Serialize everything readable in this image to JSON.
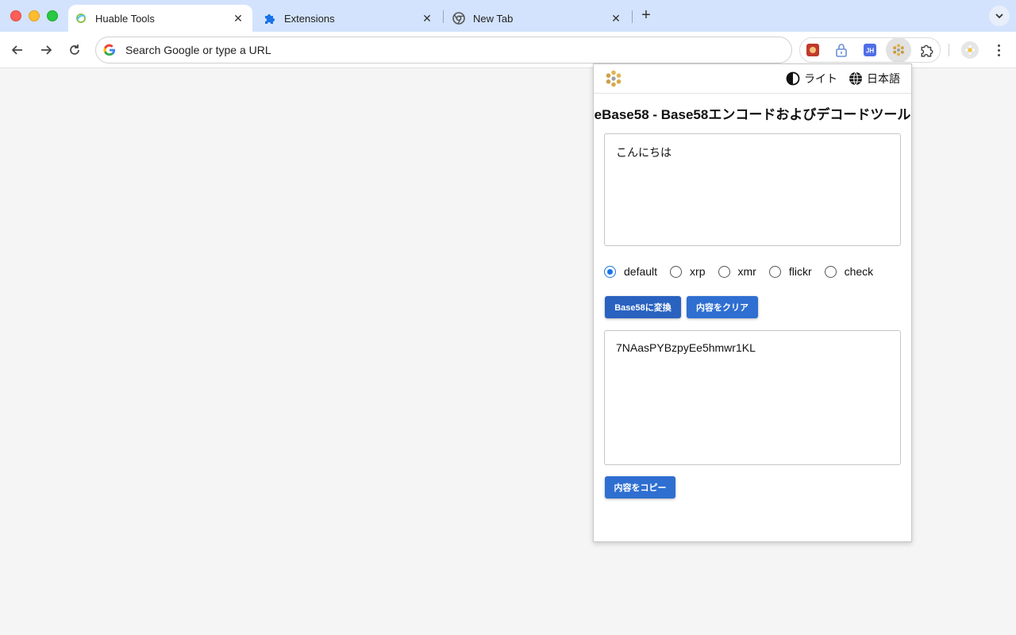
{
  "browser": {
    "tabs": [
      {
        "title": "Huable Tools",
        "active": true,
        "icon": "huable-icon"
      },
      {
        "title": "Extensions",
        "active": false,
        "icon": "puzzle-icon"
      },
      {
        "title": "New Tab",
        "active": false,
        "icon": "chrome-icon"
      }
    ],
    "omnibox_placeholder": "Search Google or type a URL"
  },
  "popup": {
    "theme_label": "ライト",
    "language_label": "日本語",
    "title": "eBase58 - Base58エンコードおよびデコードツール",
    "input_value": "こんにちは",
    "alphabets": [
      {
        "label": "default",
        "checked": true
      },
      {
        "label": "xrp",
        "checked": false
      },
      {
        "label": "xmr",
        "checked": false
      },
      {
        "label": "flickr",
        "checked": false
      },
      {
        "label": "check",
        "checked": false
      }
    ],
    "convert_button": "Base58に変換",
    "clear_button": "内容をクリア",
    "output_value": "7NAasPYBzpyEe5hmwr1KL",
    "copy_button": "内容をコピー"
  },
  "colors": {
    "tabstrip": "#d3e3fd",
    "button": "#2f6fd1",
    "radio_checked": "#1a73e8"
  }
}
